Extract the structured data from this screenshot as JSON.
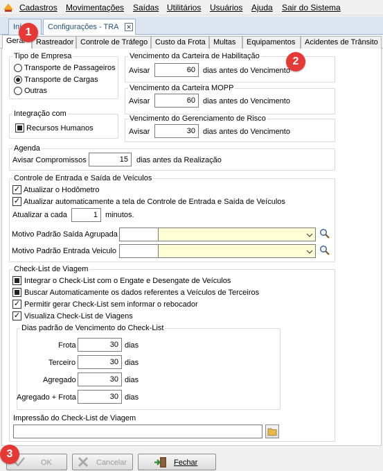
{
  "menu": {
    "items": [
      "Cadastros",
      "Movimentações",
      "Saídas",
      "Utilitários",
      "Usuários",
      "Ajuda",
      "Sair do Sistema"
    ]
  },
  "doc_tabs": {
    "inicio": "Início",
    "config": "Configurações - TRA"
  },
  "tabs": [
    "Geral",
    "Rastreador",
    "Controle de Tráfego",
    "Custo da Frota",
    "Multas",
    "Equipamentos",
    "Acidentes de Trânsito"
  ],
  "empresa": {
    "legend": "Tipo de Empresa",
    "options": [
      "Transporte de Passageiros",
      "Transporte de Cargas",
      "Outras"
    ],
    "selected": "Transporte de Cargas"
  },
  "integracao": {
    "legend": "Integração com",
    "rh_label": "Recursos Humanos"
  },
  "habilitacao": {
    "legend": "Vencimento da Carteira de Habilitação",
    "avisar": "Avisar",
    "value": "60",
    "suffix": "dias antes do Vencimento"
  },
  "mopp": {
    "legend": "Vencimento da Carteira MOPP",
    "avisar": "Avisar",
    "value": "60",
    "suffix": "dias antes do Vencimento"
  },
  "risco": {
    "legend": "Vencimento do Gerenciamento de Risco",
    "avisar": "Avisar",
    "value": "30",
    "suffix": "dias antes do Vencimento"
  },
  "agenda": {
    "legend": "Agenda",
    "label": "Avisar Compromissos",
    "value": "15",
    "suffix": "dias antes da Realização"
  },
  "controle": {
    "legend": "Controle de Entrada e Saída de Veículos",
    "hodometro": "Atualizar o Hodômetro",
    "auto_tela": "Atualizar automaticamente a tela de Controle de Entrada e Saída de Veículos",
    "atualizar_label": "Atualizar a cada",
    "atualizar_value": "1",
    "minutos": "minutos.",
    "motivo_saida": "Motivo Padrão Saída Agrupada",
    "motivo_entrada": "Motivo Padrão Entrada Veiculo"
  },
  "checklist": {
    "legend": "Check-List de Viagem",
    "engate": "Integrar o Check-List com o Engate e Desengate de Veículos",
    "buscar": "Buscar Automaticamente os dados referentes a Veículos de Terceiros",
    "permitir": "Permitir gerar Check-List sem informar o rebocador",
    "visualiza": "Visualiza Check-List de Viagens",
    "dias_legend": "Dias padrão de Vencimento do Check-List",
    "rows": [
      {
        "label": "Frota",
        "value": "30",
        "unit": "dias"
      },
      {
        "label": "Terceiro",
        "value": "30",
        "unit": "dias"
      },
      {
        "label": "Agregado",
        "value": "30",
        "unit": "dias"
      },
      {
        "label": "Agregado + Frota",
        "value": "30",
        "unit": "dias"
      }
    ],
    "impressao_label": "Impressão do Check-List de Viagem"
  },
  "buttons": {
    "ok": "OK",
    "cancelar": "Cancelar",
    "fechar": "Fechar"
  },
  "markers": [
    "1",
    "2",
    "3"
  ]
}
